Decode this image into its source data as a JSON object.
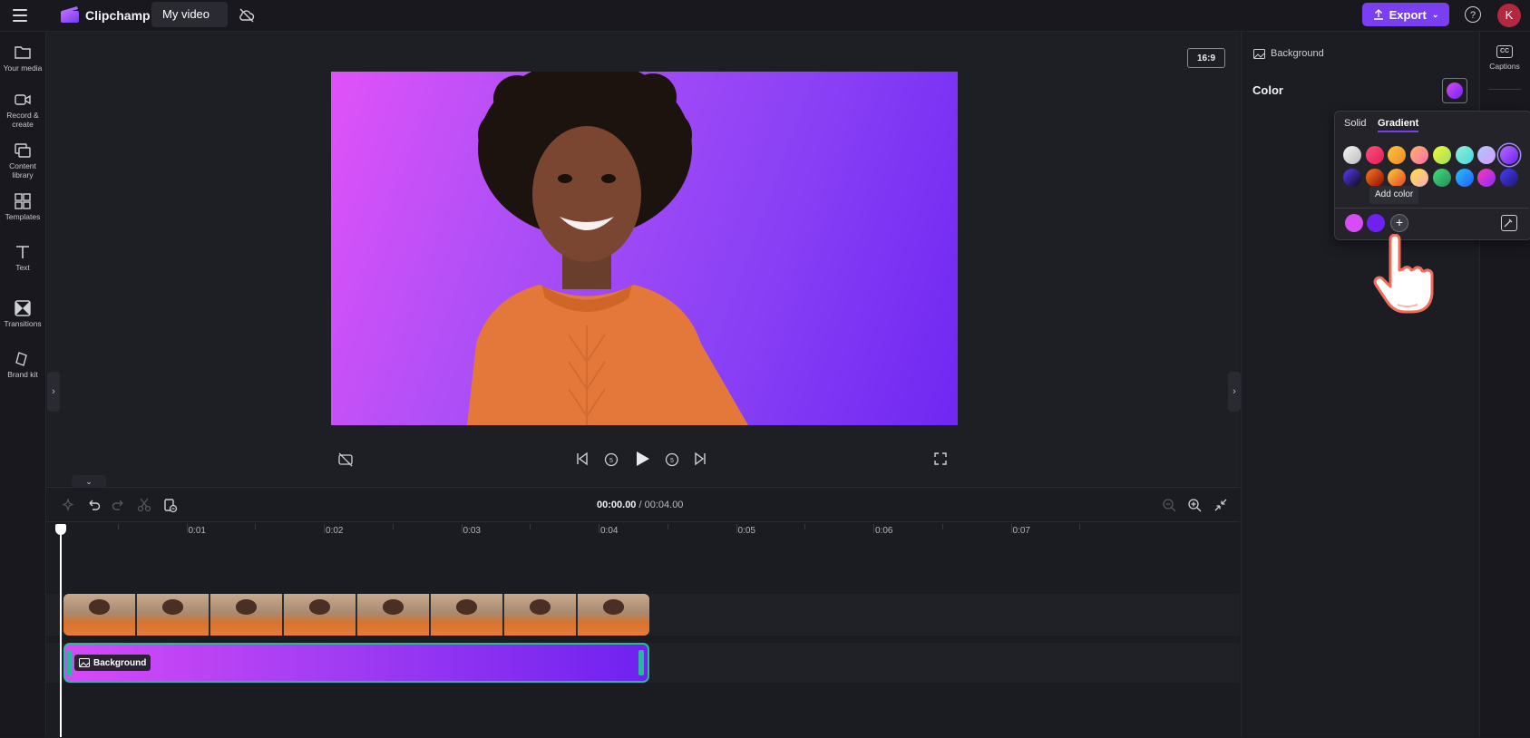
{
  "app": {
    "brand": "Clipchamp",
    "project_name": "My video",
    "export_label": "Export",
    "help_label": "?",
    "avatar_initial": "K"
  },
  "sidebar": {
    "items": [
      {
        "label": "Your media",
        "icon": "folder-icon"
      },
      {
        "label": "Record & create",
        "icon": "camera-icon"
      },
      {
        "label": "Content library",
        "icon": "library-icon"
      },
      {
        "label": "Templates",
        "icon": "templates-icon"
      },
      {
        "label": "Text",
        "icon": "text-icon"
      },
      {
        "label": "Transitions",
        "icon": "transitions-icon"
      },
      {
        "label": "Brand kit",
        "icon": "brand-kit-icon"
      }
    ]
  },
  "preview": {
    "aspect_ratio": "16:9"
  },
  "timeline": {
    "current_time": "00:00.00",
    "separator": " / ",
    "total_time": "00:04.00",
    "ticks": [
      "0",
      "0:01",
      "0:02",
      "0:03",
      "0:04",
      "0:05",
      "0:06",
      "0:07"
    ],
    "background_clip_label": "Background"
  },
  "properties": {
    "section_title": "Background",
    "color_label": "Color",
    "captions_label": "Captions"
  },
  "color_picker": {
    "tabs": {
      "solid": "Solid",
      "gradient": "Gradient"
    },
    "active_tab": "Gradient",
    "add_color_tooltip": "Add color",
    "add_button": "+",
    "selected_stops": [
      "#d84cf8",
      "#6f22ef"
    ],
    "row1": [
      [
        "#f4f4f4",
        "#bdbdbd"
      ],
      [
        "#ff4f7b",
        "#e01e5a"
      ],
      [
        "#ffc53d",
        "#f08a24"
      ],
      [
        "#ffb36b",
        "#ff6fa8"
      ],
      [
        "#f4f53a",
        "#9be15d"
      ],
      [
        "#8ff0d0",
        "#4bd6e6"
      ],
      [
        "#a7c8ff",
        "#d79cff"
      ],
      [
        "#b36bff",
        "#6f22ef"
      ]
    ],
    "row2": [
      [
        "#5c3bff",
        "#0a0a14"
      ],
      [
        "#ff7a1a",
        "#8a0a0a"
      ],
      [
        "#ffcf3a",
        "#e0402a"
      ],
      [
        "#ffe23a",
        "#f7a7c8"
      ],
      [
        "#3ee07a",
        "#2a8a5a"
      ],
      [
        "#1ec4ff",
        "#2a5bff"
      ],
      [
        "#ff3ab0",
        "#8a2aff"
      ],
      [
        "#4a3bff",
        "#1a1a6a"
      ]
    ]
  },
  "colors": {
    "accent": "#7b3ff2",
    "clip_border": "#2bb6a0",
    "canvas_start": "#e052f8",
    "canvas_end": "#7027f2"
  }
}
